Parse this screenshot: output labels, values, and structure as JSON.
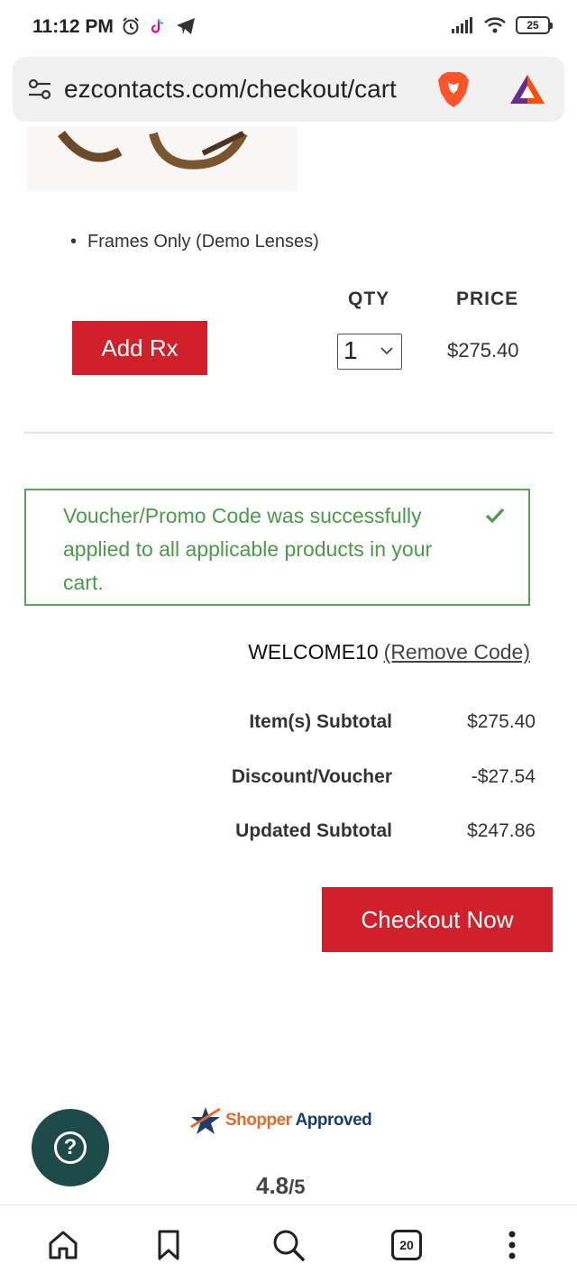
{
  "status_bar": {
    "time": "11:12 PM",
    "battery": "25",
    "left_icons": [
      "alarm-icon",
      "tiktok-icon",
      "telegram-icon"
    ],
    "right_icons": [
      "signal-icon",
      "wifi-icon",
      "battery-icon"
    ]
  },
  "browser": {
    "url": "ezcontacts.com/checkout/cart",
    "icons": [
      "site-settings-icon",
      "brave-shield-icon",
      "brave-rewards-icon"
    ]
  },
  "cart_item": {
    "lens_option": "Frames Only (Demo Lenses)",
    "qty_header": "QTY",
    "price_header": "PRICE",
    "add_rx_label": "Add Rx",
    "quantity": "1",
    "price": "$275.40"
  },
  "promo": {
    "message": "Voucher/Promo Code was successfully applied to all applicable products in your cart.",
    "code": "WELCOME10",
    "remove_label": "(Remove Code)"
  },
  "summary": {
    "rows": [
      {
        "label": "Item(s) Subtotal",
        "value": "$275.40"
      },
      {
        "label": "Discount/Voucher",
        "value": "-$27.54"
      },
      {
        "label": "Updated Subtotal",
        "value": "$247.86"
      }
    ]
  },
  "checkout_label": "Checkout Now",
  "shopper_approved": {
    "brand_part1": "Shopper",
    "brand_part2": "Approved",
    "rating": "4.8",
    "rating_max": "/5"
  },
  "bottom_nav": {
    "tab_count": "20",
    "items": [
      "home-icon",
      "bookmark-icon",
      "search-icon",
      "tabs-icon",
      "menu-icon"
    ]
  },
  "colors": {
    "accent_red": "#d0202a",
    "success_green": "#4a9a4a",
    "help_teal": "#1f4a4a"
  }
}
